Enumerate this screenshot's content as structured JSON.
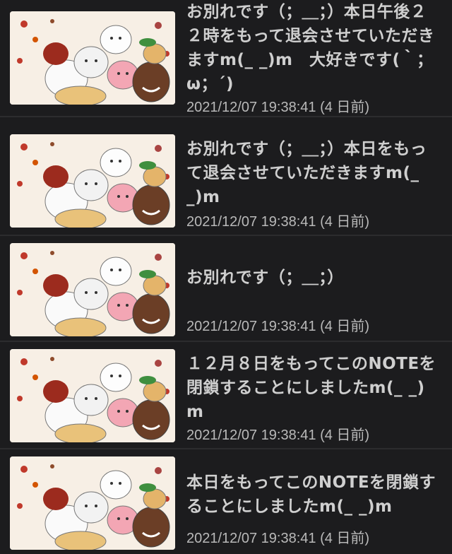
{
  "colors": {
    "background": "#1c1c1e",
    "separator": "#2c2c2e",
    "title_text": "#cfcfcf",
    "date_text": "#b9b9b9"
  },
  "thumbnail_icon": "cartoon-characters-group-image",
  "notes": [
    {
      "title": "お別れです（；＿；）本日午後２２時をもって退会させていただきますm(_ _)m　大好きです(｀；ω；´)",
      "date": "2021/12/07 19:38:41 (4 日前)"
    },
    {
      "title": "お別れです（；＿；）本日をもって退会させていただきますm(_ _)m",
      "date": "2021/12/07 19:38:41 (4 日前)"
    },
    {
      "title": "お別れです（；＿；）",
      "date": "2021/12/07 19:38:41 (4 日前)"
    },
    {
      "title": "１２月８日をもってこのNOTEを閉鎖することにしましたm(_ _)m",
      "date": "2021/12/07 19:38:41 (4 日前)"
    },
    {
      "title": "本日をもってこのNOTEを閉鎖することにしましたm(_ _)m",
      "date": "2021/12/07 19:38:41 (4 日前)"
    }
  ]
}
